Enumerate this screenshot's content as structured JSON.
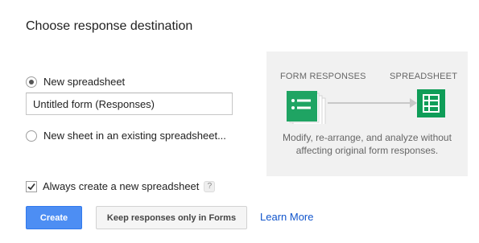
{
  "dialog": {
    "title": "Choose response destination",
    "options": [
      {
        "label": "New spreadsheet",
        "selected": true
      },
      {
        "label": "New sheet in an existing spreadsheet...",
        "selected": false
      }
    ],
    "spreadsheet_name": {
      "value": "Untitled form (Responses)",
      "placeholder": ""
    },
    "always_create": {
      "label": "Always create a new spreadsheet",
      "checked": true,
      "help_icon": "?"
    },
    "buttons": {
      "create": "Create",
      "keep_in_forms": "Keep responses only in Forms"
    },
    "learn_more": "Learn More"
  },
  "illustration": {
    "source_label": "FORM RESPONSES",
    "target_label": "SPREADSHEET",
    "caption_line1": "Modify, re-arrange, and analyze without",
    "caption_line2": "affecting original form responses.",
    "colors": {
      "form_green": "#1fa463",
      "sheet_green": "#0f9d58",
      "background": "#f1f1f1",
      "arrow": "#c8c8c8"
    },
    "icons": [
      "form-responses-icon",
      "spreadsheet-icon",
      "arrow-icon"
    ]
  },
  "colors": {
    "primary_button": "#4d8ef3",
    "link": "#1155cc"
  }
}
